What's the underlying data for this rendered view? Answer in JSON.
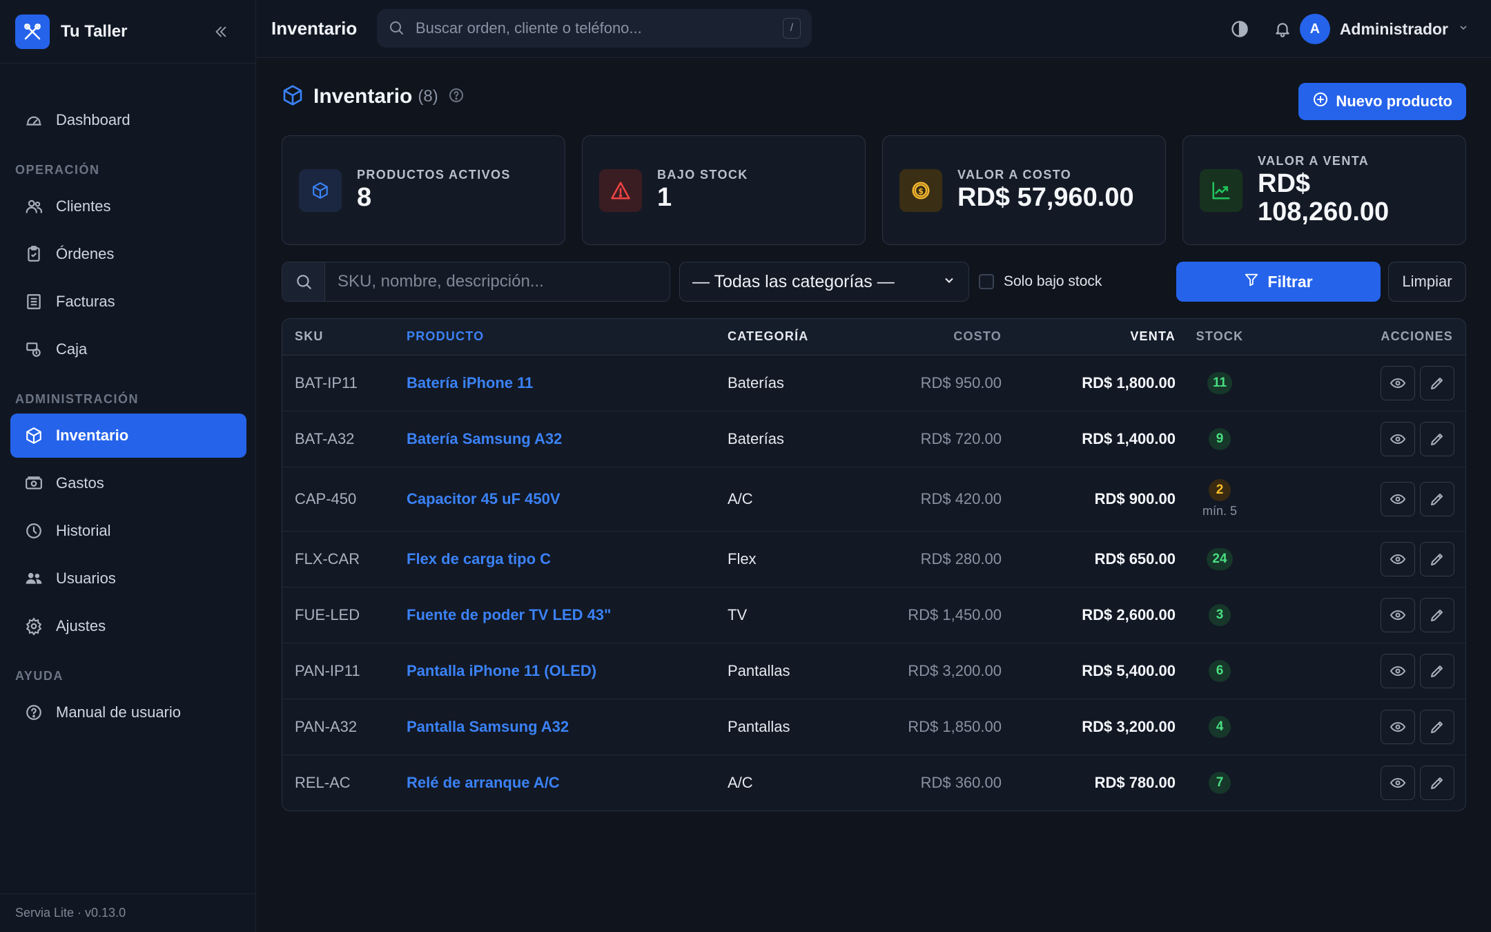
{
  "app": {
    "name": "Tu Taller",
    "footer": "Servia Lite · v0.13.0"
  },
  "sidebar": {
    "top_item": {
      "label": "Dashboard",
      "icon": "gauge-icon"
    },
    "sections": [
      {
        "title": "OPERACIÓN",
        "items": [
          {
            "label": "Clientes",
            "icon": "users-icon"
          },
          {
            "label": "Órdenes",
            "icon": "clipboard-icon"
          },
          {
            "label": "Facturas",
            "icon": "invoice-icon"
          },
          {
            "label": "Caja",
            "icon": "cash-register-icon"
          }
        ]
      },
      {
        "title": "ADMINISTRACIÓN",
        "items": [
          {
            "label": "Inventario",
            "icon": "box-icon",
            "active": true
          },
          {
            "label": "Gastos",
            "icon": "banknote-icon"
          },
          {
            "label": "Historial",
            "icon": "clock-icon"
          },
          {
            "label": "Usuarios",
            "icon": "people-icon"
          },
          {
            "label": "Ajustes",
            "icon": "gear-icon"
          }
        ]
      },
      {
        "title": "AYUDA",
        "items": [
          {
            "label": "Manual de usuario",
            "icon": "question-circle-icon"
          }
        ]
      }
    ]
  },
  "topbar": {
    "title": "Inventario",
    "search_placeholder": "Buscar orden, cliente o teléfono...",
    "search_shortcut": "/",
    "user_initial": "A",
    "user_name": "Administrador"
  },
  "page": {
    "title": "Inventario",
    "count": "(8)",
    "new_button": "Nuevo producto"
  },
  "stats": [
    {
      "label": "PRODUCTOS ACTIVOS",
      "value": "8",
      "icon": "box-icon",
      "accent": "#3b82f6",
      "bg": "#1b2740"
    },
    {
      "label": "BAJO STOCK",
      "value": "1",
      "icon": "warning-icon",
      "accent": "#ef4444",
      "bg": "#3a1d22"
    },
    {
      "label": "VALOR A COSTO",
      "value": "RD$ 57,960.00",
      "icon": "coin-icon",
      "accent": "#f5b82e",
      "bg": "#3a2e14"
    },
    {
      "label": "VALOR A VENTA",
      "value": "RD$ 108,260.00",
      "icon": "trending-up-icon",
      "accent": "#22c55e",
      "bg": "#17331f"
    }
  ],
  "filters": {
    "search_placeholder": "SKU, nombre, descripción...",
    "category_selected": "— Todas las categorías —",
    "low_stock_label": "Solo bajo stock",
    "low_stock_checked": false,
    "filter_button": "Filtrar",
    "clear_button": "Limpiar"
  },
  "table": {
    "columns": [
      "SKU",
      "PRODUCTO",
      "CATEGORÍA",
      "COSTO",
      "VENTA",
      "STOCK",
      "ACCIONES"
    ],
    "rows": [
      {
        "sku": "BAT-IP11",
        "product": "Batería iPhone 11",
        "category": "Baterías",
        "cost": "RD$ 950.00",
        "sale": "RD$ 1,800.00",
        "stock": "11",
        "min": ""
      },
      {
        "sku": "BAT-A32",
        "product": "Batería Samsung A32",
        "category": "Baterías",
        "cost": "RD$ 720.00",
        "sale": "RD$ 1,400.00",
        "stock": "9",
        "min": ""
      },
      {
        "sku": "CAP-450",
        "product": "Capacitor 45 uF 450V",
        "category": "A/C",
        "cost": "RD$ 420.00",
        "sale": "RD$ 900.00",
        "stock": "2",
        "min": "mín. 5"
      },
      {
        "sku": "FLX-CAR",
        "product": "Flex de carga tipo C",
        "category": "Flex",
        "cost": "RD$ 280.00",
        "sale": "RD$ 650.00",
        "stock": "24",
        "min": ""
      },
      {
        "sku": "FUE-LED",
        "product": "Fuente de poder TV LED 43\"",
        "category": "TV",
        "cost": "RD$ 1,450.00",
        "sale": "RD$ 2,600.00",
        "stock": "3",
        "min": ""
      },
      {
        "sku": "PAN-IP11",
        "product": "Pantalla iPhone 11 (OLED)",
        "category": "Pantallas",
        "cost": "RD$ 3,200.00",
        "sale": "RD$ 5,400.00",
        "stock": "6",
        "min": ""
      },
      {
        "sku": "PAN-A32",
        "product": "Pantalla Samsung A32",
        "category": "Pantallas",
        "cost": "RD$ 1,850.00",
        "sale": "RD$ 3,200.00",
        "stock": "4",
        "min": ""
      },
      {
        "sku": "REL-AC",
        "product": "Relé de arranque A/C",
        "category": "A/C",
        "cost": "RD$ 360.00",
        "sale": "RD$ 780.00",
        "stock": "7",
        "min": ""
      }
    ]
  }
}
